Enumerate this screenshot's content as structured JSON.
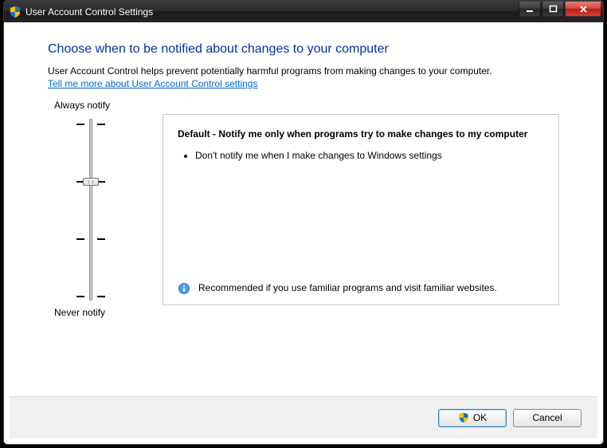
{
  "window": {
    "title": "User Account Control Settings"
  },
  "page": {
    "heading": "Choose when to be notified about changes to your computer",
    "description": "User Account Control helps prevent potentially harmful programs from making changes to your computer.",
    "help_link": "Tell me more about User Account Control settings"
  },
  "slider": {
    "top_label": "Always notify",
    "bottom_label": "Never notify",
    "levels": 4,
    "current_level_index": 1
  },
  "panel": {
    "title": "Default - Notify me only when programs try to make changes to my computer",
    "bullets": [
      "Don't notify me when I make changes to Windows settings"
    ],
    "recommendation": "Recommended if you use familiar programs and visit familiar websites."
  },
  "footer": {
    "ok_label": "OK",
    "cancel_label": "Cancel"
  }
}
